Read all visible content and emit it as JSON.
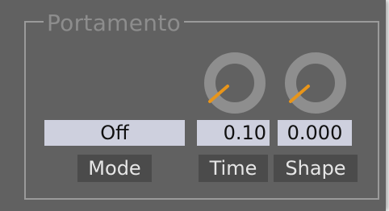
{
  "group": {
    "title": "Portamento"
  },
  "mode": {
    "value": "Off",
    "label": "Mode"
  },
  "time": {
    "value": "0.10",
    "label": "Time",
    "knob_icon": "knob-icon"
  },
  "shape": {
    "value": "0.000",
    "label": "Shape",
    "knob_icon": "knob-icon"
  },
  "colors": {
    "panel_bg": "#616161",
    "frame": "#9a9a9a",
    "knob_ring": "#8e8e8e",
    "knob_pointer": "#e8951a",
    "value_bg": "#ced0de",
    "label_bg": "#4b4b4b"
  }
}
